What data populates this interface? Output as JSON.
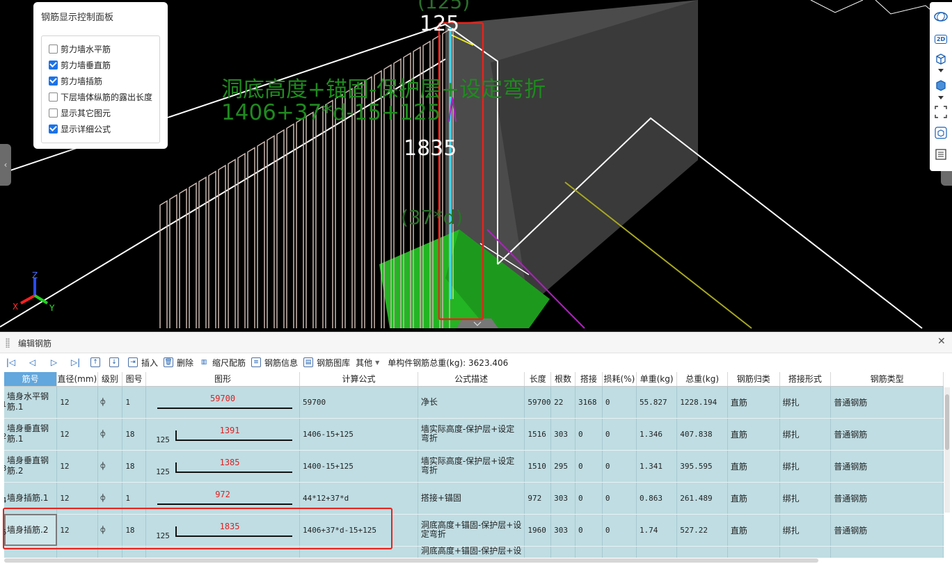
{
  "viewport": {
    "labels": {
      "top_partial": "(125)",
      "top_value": "125",
      "formula_desc": "洞底高度+锚固-保护层+设定弯折",
      "formula_expr": "1406+37*d-15+125",
      "length": "1835",
      "anchor": "(37*d)"
    },
    "axes": {
      "x": "X",
      "y": "Y",
      "z": "Z"
    },
    "colors": {
      "highlight": "#e8221b",
      "green_text": "#1f8a1f",
      "ground": "#23b523",
      "wall": "#4a4a4a"
    }
  },
  "control_panel": {
    "title": "钢筋显示控制面板",
    "options": [
      {
        "label": "剪力墙水平筋",
        "checked": false
      },
      {
        "label": "剪力墙垂直筋",
        "checked": true
      },
      {
        "label": "剪力墙插筋",
        "checked": true
      },
      {
        "label": "下层墙体纵筋的露出长度",
        "checked": false
      },
      {
        "label": "显示其它图元",
        "checked": false
      },
      {
        "label": "显示详细公式",
        "checked": true
      }
    ]
  },
  "view_toolbar": {
    "icons": [
      "orbit-icon",
      "2d-view-icon",
      "3d-box-icon",
      "filled-box-icon",
      "fit-view-icon",
      "cube-view-icon",
      "list-icon"
    ],
    "label_2d": "2D"
  },
  "edit_panel": {
    "title": "编辑钢筋",
    "toolbar": {
      "insert": "插入",
      "delete": "删除",
      "scale": "缩尺配筋",
      "info": "钢筋信息",
      "library": "钢筋图库",
      "other": "其他",
      "total": "单构件钢筋总重(kg): 3623.406"
    },
    "columns": [
      "筋号",
      "直径(mm)",
      "级别",
      "图号",
      "图形",
      "计算公式",
      "公式描述",
      "长度",
      "根数",
      "搭接",
      "损耗(%)",
      "单重(kg)",
      "总重(kg)",
      "钢筋归类",
      "搭接形式",
      "钢筋类型"
    ],
    "rows": [
      {
        "n": "1",
        "name": "墙身水平钢筋.1",
        "dia": "12",
        "grade": "⌽",
        "fig": "1",
        "shape_left": "",
        "shape_val": "59700",
        "formula": "59700",
        "desc": "净长",
        "len": "59700",
        "count": "22",
        "lap": "3168",
        "loss": "0",
        "unit_w": "55.827",
        "total_w": "1228.194",
        "cat": "直筋",
        "lap_type": "绑扎",
        "type": "普通钢筋"
      },
      {
        "n": "2",
        "name": "墙身垂直钢筋.1",
        "dia": "12",
        "grade": "⌽",
        "fig": "18",
        "shape_left": "125",
        "shape_val": "1391",
        "formula": "1406-15+125",
        "desc": "墙实际高度-保护层+设定弯折",
        "len": "1516",
        "count": "303",
        "lap": "0",
        "loss": "0",
        "unit_w": "1.346",
        "total_w": "407.838",
        "cat": "直筋",
        "lap_type": "绑扎",
        "type": "普通钢筋"
      },
      {
        "n": "3",
        "name": "墙身垂直钢筋.2",
        "dia": "12",
        "grade": "⌽",
        "fig": "18",
        "shape_left": "125",
        "shape_val": "1385",
        "formula": "1400-15+125",
        "desc": "墙实际高度-保护层+设定弯折",
        "len": "1510",
        "count": "295",
        "lap": "0",
        "loss": "0",
        "unit_w": "1.341",
        "total_w": "395.595",
        "cat": "直筋",
        "lap_type": "绑扎",
        "type": "普通钢筋"
      },
      {
        "n": "4",
        "name": "墙身插筋.1",
        "dia": "12",
        "grade": "⌽",
        "fig": "1",
        "shape_left": "",
        "shape_val": "972",
        "formula": "44*12+37*d",
        "desc": "搭接+锚固",
        "len": "972",
        "count": "303",
        "lap": "0",
        "loss": "0",
        "unit_w": "0.863",
        "total_w": "261.489",
        "cat": "直筋",
        "lap_type": "绑扎",
        "type": "普通钢筋"
      },
      {
        "n": "5",
        "name": "墙身插筋.2",
        "dia": "12",
        "grade": "⌽",
        "fig": "18",
        "shape_left": "125",
        "shape_val": "1835",
        "formula": "1406+37*d-15+125",
        "desc": "洞底高度+锚固-保护层+设定弯折",
        "len": "1960",
        "count": "303",
        "lap": "0",
        "loss": "0",
        "unit_w": "1.74",
        "total_w": "527.22",
        "cat": "直筋",
        "lap_type": "绑扎",
        "type": "普通钢筋"
      }
    ],
    "partial_desc": "洞底高度+锚固-保护层+设"
  }
}
